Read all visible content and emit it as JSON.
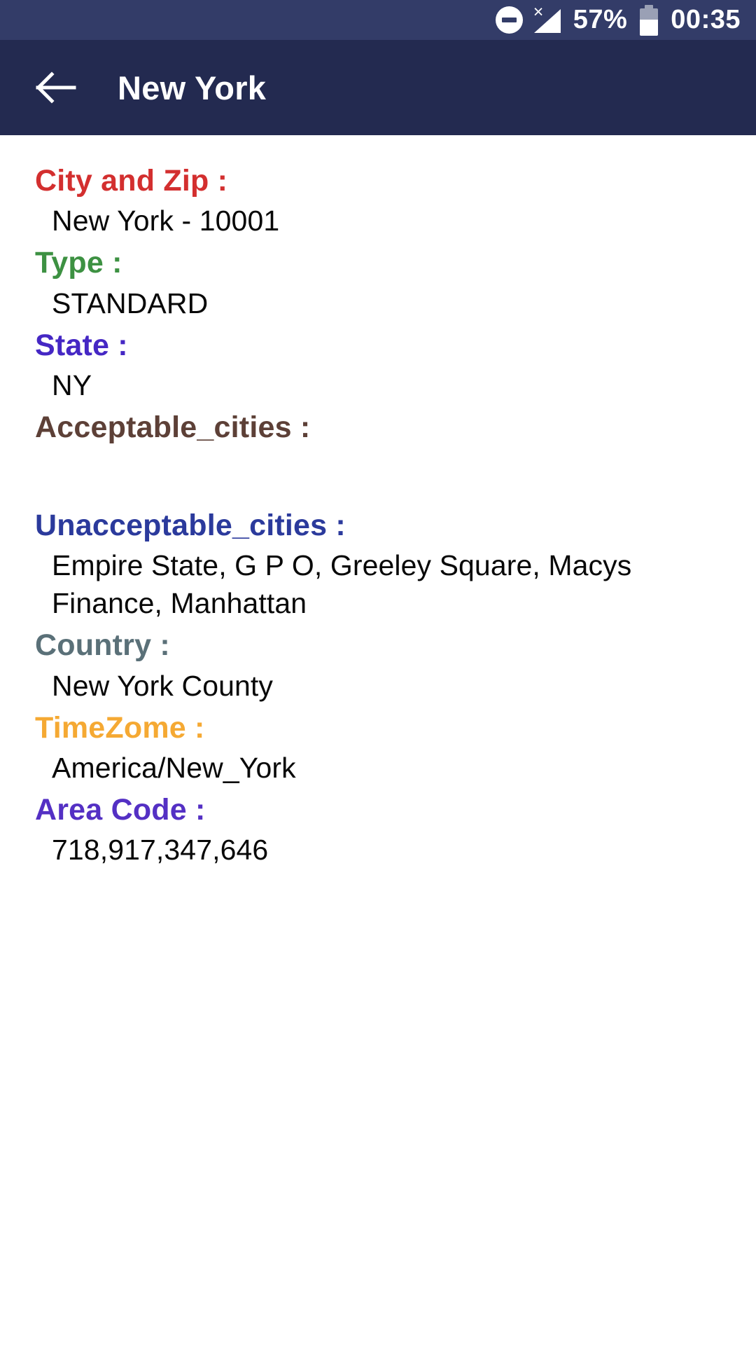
{
  "status_bar": {
    "dnd_icon": "do-not-disturb-icon",
    "signal_icon": "no-signal-icon",
    "battery_percent_text": "57%",
    "battery_level": 57,
    "battery_icon": "battery-icon",
    "clock": "00:35",
    "background_color": "#333c68"
  },
  "app_bar": {
    "back_icon": "arrow-left-icon",
    "title": "New York",
    "background_color": "#232a50",
    "text_color": "#ffffff"
  },
  "details": {
    "fields": [
      {
        "label": "City and Zip :",
        "value": "New York - 10001",
        "label_color": "#d32f2f"
      },
      {
        "label": "Type :",
        "value": "STANDARD",
        "label_color": "#3d9142"
      },
      {
        "label": "State :",
        "value": "NY",
        "label_color": "#4527c4"
      },
      {
        "label": "Acceptable_cities :",
        "value": "",
        "label_color": "#5d4037"
      },
      {
        "label": "Unacceptable_cities :",
        "value": "Empire State, G P O, Greeley Square, Macys Finance, Manhattan",
        "label_color": "#2b3a9c"
      },
      {
        "label": "Country :",
        "value": "New York County",
        "label_color": "#5a7078"
      },
      {
        "label": "TimeZome :",
        "value": "America/New_York",
        "label_color": "#f5a933"
      },
      {
        "label": "Area Code :",
        "value": "718,917,347,646",
        "label_color": "#5430c4"
      }
    ]
  }
}
